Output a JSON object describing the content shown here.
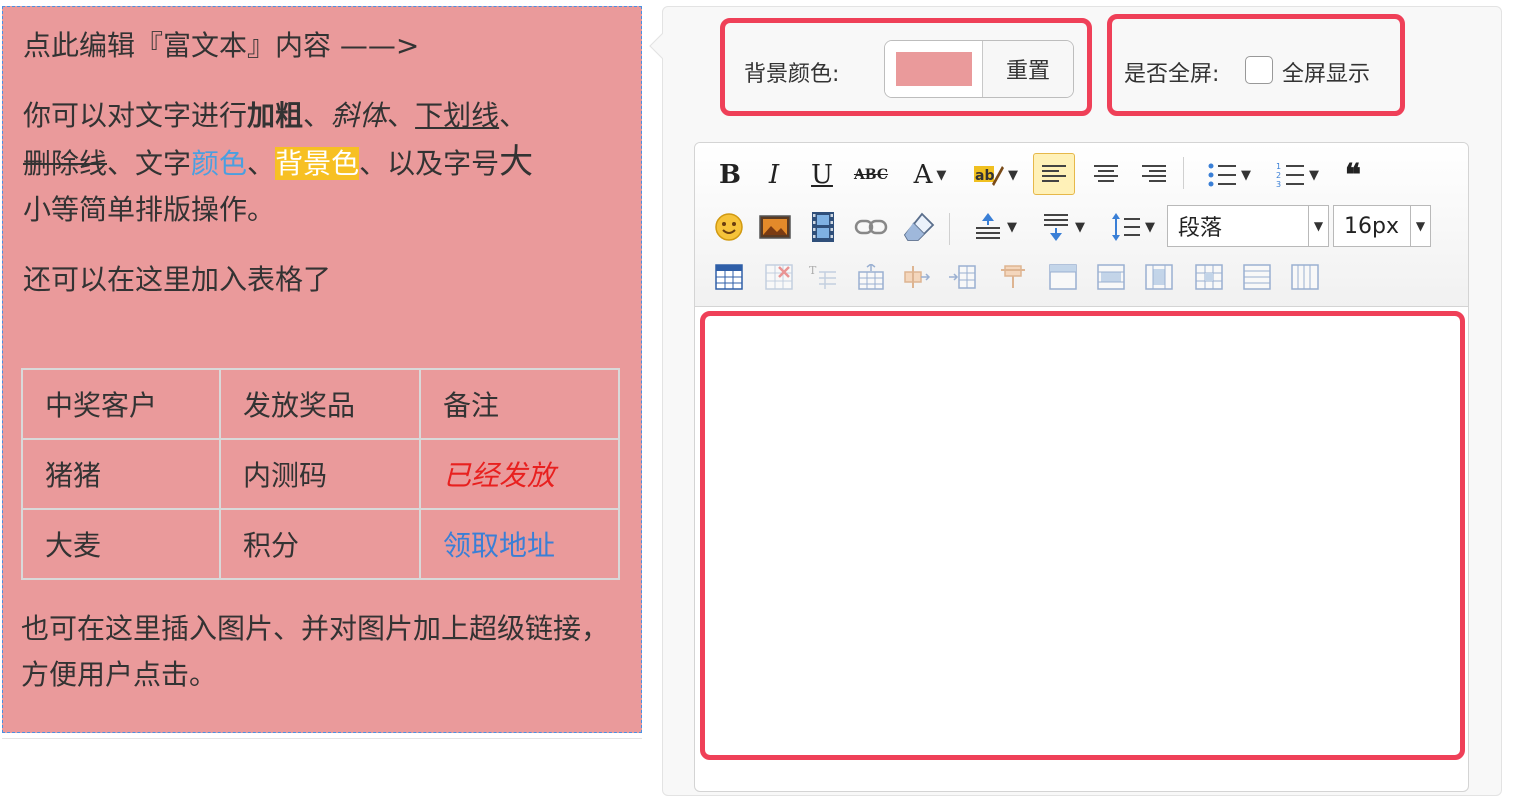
{
  "preview": {
    "line1": "点此编辑『富文本』内容 ——>",
    "p2": {
      "t1": "你可以对文字进行",
      "bold": "加粗",
      "sep1": "、",
      "italic": "斜体",
      "sep2": "、",
      "underline": "下划线",
      "sep3": "、",
      "strike": "删除线",
      "t2": "、文字",
      "colored": "颜色",
      "sep4": "、",
      "bgcolor": "背景色",
      "t3": "、以及字号",
      "big": "大",
      "t4": "小等简单排版操作。"
    },
    "line3": "还可以在这里加入表格了",
    "table": {
      "rows": [
        [
          "中奖客户",
          "发放奖品",
          "备注"
        ],
        [
          "猪猪",
          "内测码",
          "已经发放"
        ],
        [
          "大麦",
          "积分",
          "领取地址"
        ]
      ]
    },
    "line4": "也可在这里插入图片、并对图片加上超级链接，方便用户点击。"
  },
  "settings": {
    "bg_color_label": "背景颜色:",
    "reset_label": "重置",
    "fullscreen_label": "是否全屏:",
    "fullscreen_option": "全屏显示",
    "fullscreen_checked": false
  },
  "toolbar": {
    "bold": "B",
    "italic": "I",
    "underline": "U",
    "strikethrough": "ABC",
    "font_color": "A",
    "paragraph_value": "段落",
    "font_size_value": "16px"
  },
  "colors": {
    "preview_bg": "#ea9a9b",
    "link_blue": "#3a7fd6",
    "light_blue": "#4a9fe0",
    "highlight_bg": "#f7c023",
    "red_text": "#e8201f",
    "accent_red": "#ef4058"
  }
}
